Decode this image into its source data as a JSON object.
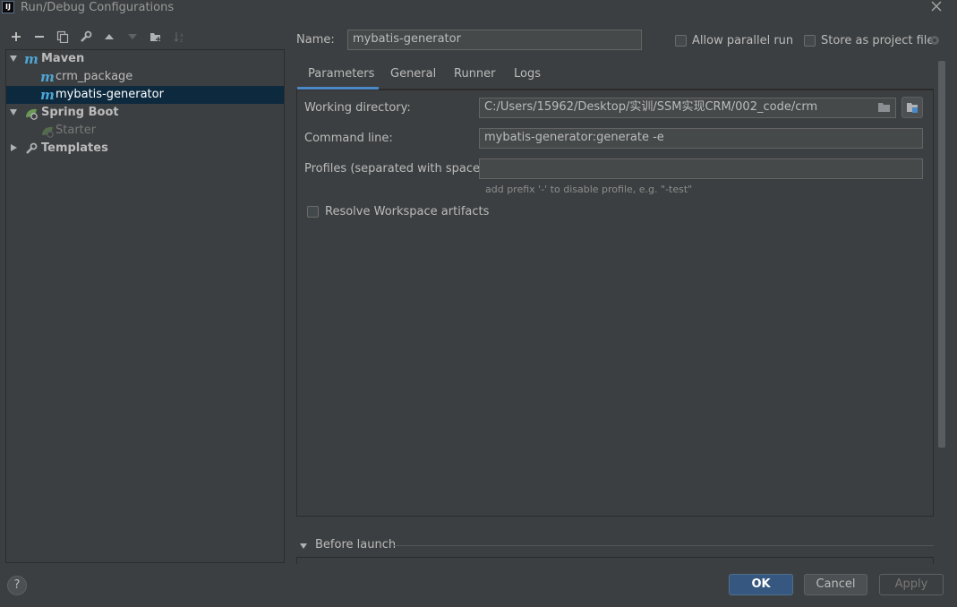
{
  "window": {
    "title": "Run/Debug Configurations",
    "app_icon_text": "IJ"
  },
  "toolbar": {
    "icons": [
      "add-icon",
      "remove-icon",
      "copy-icon",
      "wrench-icon",
      "move-up-icon",
      "move-down-icon",
      "new-folder-icon",
      "sort-icon"
    ]
  },
  "tree": {
    "maven": "Maven",
    "maven_items": [
      "crm_package",
      "mybatis-generator"
    ],
    "spring_boot": "Spring Boot",
    "spring_items": [
      "Starter"
    ],
    "templates": "Templates"
  },
  "form": {
    "name_label": "Name:",
    "name_value": "mybatis-generator",
    "allow_parallel": "Allow parallel run",
    "store_project": "Store as project file"
  },
  "tabs": [
    "Parameters",
    "General",
    "Runner",
    "Logs"
  ],
  "params": {
    "working_dir_label": "Working directory:",
    "working_dir_value": "C:/Users/15962/Desktop/实训/SSM实现CRM/002_code/crm",
    "command_line_label": "Command line:",
    "command_line_value": "mybatis-generator:generate -e",
    "profiles_label": "Profiles (separated with space):",
    "profiles_value": "",
    "profiles_hint": "add prefix '-' to disable profile, e.g. \"-test\"",
    "resolve_workspace": "Resolve Workspace artifacts"
  },
  "before_launch": "Before launch",
  "buttons": {
    "ok": "OK",
    "cancel": "Cancel",
    "apply": "Apply",
    "help": "?"
  },
  "colors": {
    "background": "#3c3f41",
    "selection": "#0d293e",
    "accent": "#4a88c7",
    "ok_button": "#365880",
    "maven_icon": "#4ea6d6",
    "spring_icon": "#6a9955"
  }
}
